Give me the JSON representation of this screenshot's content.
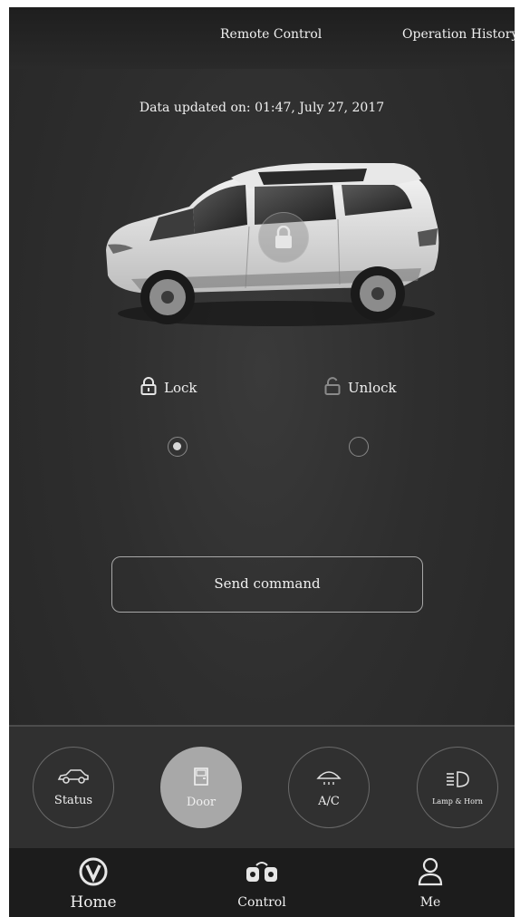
{
  "header": {
    "tabs": [
      {
        "label": "Remote Control"
      },
      {
        "label": "Operation History"
      }
    ]
  },
  "status": {
    "updated_text": "Data updated on: 01:47, July 27, 2017"
  },
  "vehicle": {
    "state_icon": "lock-icon"
  },
  "door_options": [
    {
      "label": "Lock",
      "icon": "lock-icon",
      "selected": true
    },
    {
      "label": "Unlock",
      "icon": "unlock-icon",
      "selected": false
    }
  ],
  "actions": {
    "send_label": "Send command"
  },
  "function_tabs": [
    {
      "label": "Status",
      "icon": "car-icon",
      "active": false
    },
    {
      "label": "Door",
      "icon": "door-icon",
      "active": true
    },
    {
      "label": "A/C",
      "icon": "ac-icon",
      "active": false
    },
    {
      "label": "Lamp & Horn",
      "icon": "headlamp-icon",
      "active": false
    }
  ],
  "bottom_nav": [
    {
      "label": "Home",
      "icon": "brand-logo-icon"
    },
    {
      "label": "Control",
      "icon": "control-icon"
    },
    {
      "label": "Me",
      "icon": "person-icon"
    }
  ],
  "colors": {
    "background": "#2e2e2e",
    "active_tab": "#a8a8a8",
    "nav_background": "#1c1c1c"
  }
}
